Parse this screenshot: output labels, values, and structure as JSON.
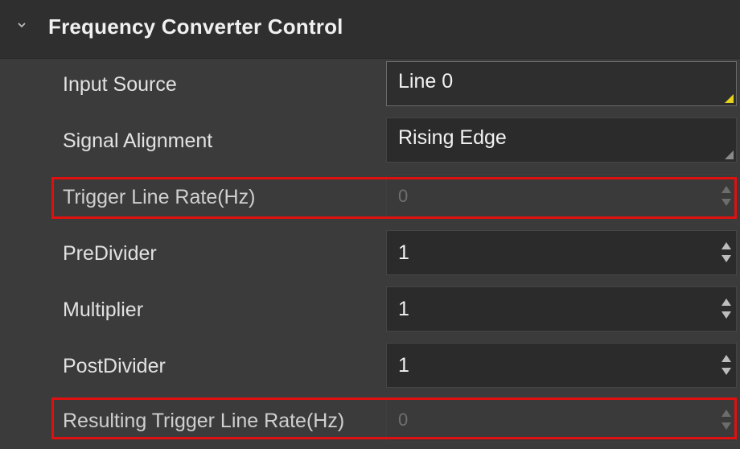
{
  "section": {
    "title": "Frequency Converter Control",
    "expanded": true
  },
  "rows": [
    {
      "label": "Input Source",
      "value": "Line 0",
      "control": "combo",
      "state": "focused"
    },
    {
      "label": "Signal Alignment",
      "value": "Rising Edge",
      "control": "combo",
      "state": "normal"
    },
    {
      "label": "Trigger Line Rate(Hz)",
      "value": "0",
      "control": "spin",
      "state": "disabled",
      "highlighted": true
    },
    {
      "label": "PreDivider",
      "value": "1",
      "control": "spin",
      "state": "normal"
    },
    {
      "label": "Multiplier",
      "value": "1",
      "control": "spin",
      "state": "normal"
    },
    {
      "label": "PostDivider",
      "value": "1",
      "control": "spin",
      "state": "normal"
    },
    {
      "label": "Resulting Trigger Line Rate(Hz)",
      "value": "0",
      "control": "spin",
      "state": "disabled",
      "highlighted": true
    }
  ],
  "colors": {
    "highlight": "#e01010",
    "combo_focus_corner": "#e3d31a",
    "background": "#3b3b3b",
    "field": "#2b2b2b"
  },
  "icons": {
    "collapse": "chevron-down-icon",
    "combo": "dropdown-corner-icon",
    "spin_up": "spin-up-icon",
    "spin_down": "spin-down-icon"
  }
}
